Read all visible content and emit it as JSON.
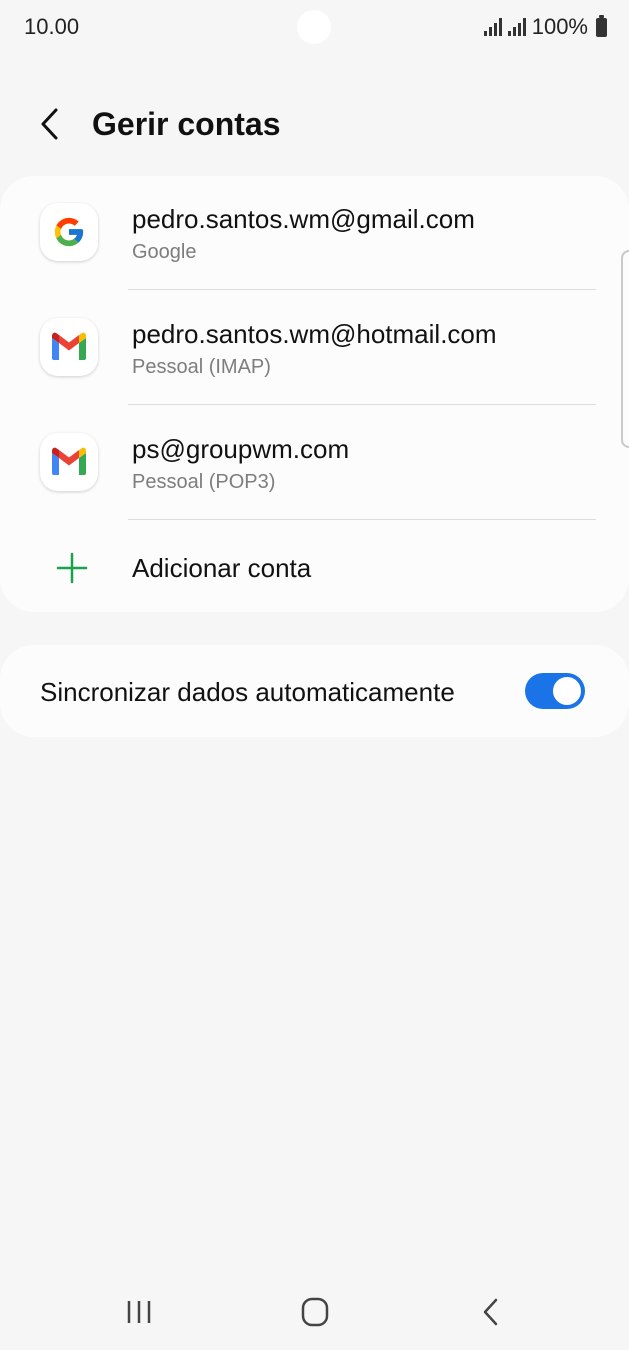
{
  "status_bar": {
    "time": "10.00",
    "battery": "100%",
    "icons": [
      "signal-icon",
      "signal-icon",
      "battery-icon"
    ]
  },
  "header": {
    "title": "Gerir contas",
    "back_icon": "chevron-left-icon"
  },
  "accounts": [
    {
      "email": "pedro.santos.wm@gmail.com",
      "type": "Google",
      "icon": "google-icon"
    },
    {
      "email": "pedro.santos.wm@hotmail.com",
      "type": "Pessoal (IMAP)",
      "icon": "gmail-icon"
    },
    {
      "email": "ps@groupwm.com",
      "type": "Pessoal (POP3)",
      "icon": "gmail-icon"
    }
  ],
  "add_account": {
    "label": "Adicionar conta",
    "icon": "plus-icon",
    "color": "#1aa34a"
  },
  "sync": {
    "label": "Sincronizar dados automaticamente",
    "enabled": true,
    "accent": "#1b73e8"
  },
  "nav_bar": {
    "icons": [
      "recents-icon",
      "home-icon",
      "back-icon"
    ]
  }
}
